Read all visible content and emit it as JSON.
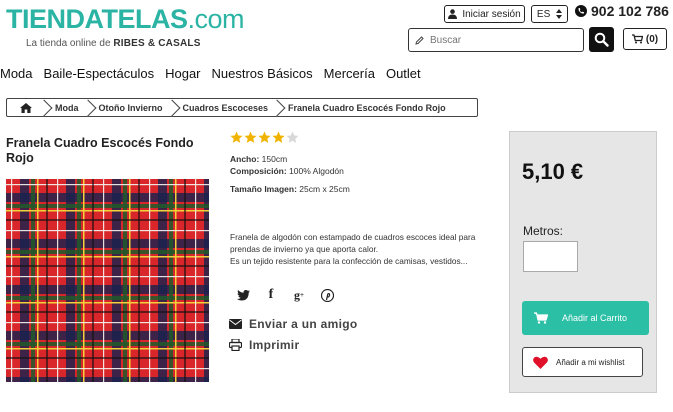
{
  "header": {
    "logo_main": "TIENDATELAS",
    "logo_suffix": ".com",
    "logo_tagline": "La tienda online de",
    "logo_brand": "RIBES & CASALS",
    "login_label": "Iniciar sesión",
    "language": "ES",
    "phone": "902 102 786",
    "search_placeholder": "Buscar",
    "cart_count": "(0)"
  },
  "nav": [
    "Moda",
    "Baile-Espectáculos",
    "Hogar",
    "Nuestros Básicos",
    "Mercería",
    "Outlet"
  ],
  "breadcrumb": [
    "Moda",
    "Otoño Invierno",
    "Cuadros Escoceses",
    "Franela Cuadro Escocés Fondo Rojo"
  ],
  "product": {
    "title": "Franela Cuadro Escocés Fondo Rojo",
    "rating": 4,
    "rating_max": 5,
    "specs": {
      "ancho_label": "Ancho:",
      "ancho_value": "150cm",
      "composicion_label": "Composición:",
      "composicion_value": "100% Algodón",
      "tamano_label": "Tamaño Imagen:",
      "tamano_value": "25cm x 25cm"
    },
    "description": [
      "Franela de algodón con estampado de cuadros escoces ideal para",
      "prendas de invierno ya que aporta calor.",
      "Es un tejido resistente para la confección de camisas, vestidos..."
    ],
    "send_friend": "Enviar a un amigo",
    "print": "Imprimir"
  },
  "buy": {
    "price": "5,10 €",
    "metros_label": "Metros:",
    "metros_value": "",
    "add_to_cart": "Añadir al Carrito",
    "wishlist": "Añadir a mi wishlist"
  },
  "colors": {
    "brand": "#2bb3a3",
    "cart_button": "#2bbfa6",
    "buybox_bg": "#e6e6e6",
    "heart": "#e0102a"
  }
}
